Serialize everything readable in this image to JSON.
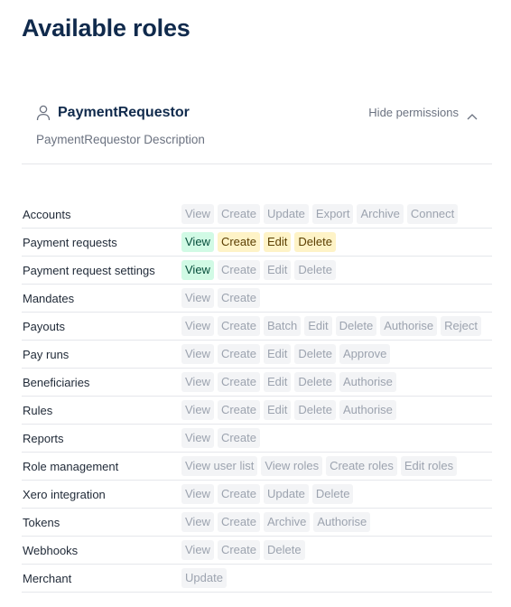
{
  "page": {
    "title": "Available roles"
  },
  "role": {
    "name": "PaymentRequestor",
    "description": "PaymentRequestor Description",
    "toggle_label": "Hide permissions",
    "icon": "person-icon"
  },
  "colors": {
    "granted_view": "#d1fae5",
    "granted_edit": "#fef3c7",
    "not_granted": "#f3f4f6"
  },
  "permissions": [
    {
      "label": "Accounts",
      "actions": [
        {
          "text": "View",
          "state": "off"
        },
        {
          "text": "Create",
          "state": "off"
        },
        {
          "text": "Update",
          "state": "off"
        },
        {
          "text": "Export",
          "state": "off"
        },
        {
          "text": "Archive",
          "state": "off"
        },
        {
          "text": "Connect",
          "state": "off"
        }
      ]
    },
    {
      "label": "Payment requests",
      "actions": [
        {
          "text": "View",
          "state": "green"
        },
        {
          "text": "Create",
          "state": "yellow"
        },
        {
          "text": "Edit",
          "state": "yellow"
        },
        {
          "text": "Delete",
          "state": "yellow"
        }
      ]
    },
    {
      "label": "Payment request settings",
      "actions": [
        {
          "text": "View",
          "state": "green"
        },
        {
          "text": "Create",
          "state": "off"
        },
        {
          "text": "Edit",
          "state": "off"
        },
        {
          "text": "Delete",
          "state": "off"
        }
      ]
    },
    {
      "label": "Mandates",
      "actions": [
        {
          "text": "View",
          "state": "off"
        },
        {
          "text": "Create",
          "state": "off"
        }
      ]
    },
    {
      "label": "Payouts",
      "actions": [
        {
          "text": "View",
          "state": "off"
        },
        {
          "text": "Create",
          "state": "off"
        },
        {
          "text": "Batch",
          "state": "off"
        },
        {
          "text": "Edit",
          "state": "off"
        },
        {
          "text": "Delete",
          "state": "off"
        },
        {
          "text": "Authorise",
          "state": "off"
        },
        {
          "text": "Reject",
          "state": "off"
        }
      ]
    },
    {
      "label": "Pay runs",
      "actions": [
        {
          "text": "View",
          "state": "off"
        },
        {
          "text": "Create",
          "state": "off"
        },
        {
          "text": "Edit",
          "state": "off"
        },
        {
          "text": "Delete",
          "state": "off"
        },
        {
          "text": "Approve",
          "state": "off"
        }
      ]
    },
    {
      "label": "Beneficiaries",
      "actions": [
        {
          "text": "View",
          "state": "off"
        },
        {
          "text": "Create",
          "state": "off"
        },
        {
          "text": "Edit",
          "state": "off"
        },
        {
          "text": "Delete",
          "state": "off"
        },
        {
          "text": "Authorise",
          "state": "off"
        }
      ]
    },
    {
      "label": "Rules",
      "actions": [
        {
          "text": "View",
          "state": "off"
        },
        {
          "text": "Create",
          "state": "off"
        },
        {
          "text": "Edit",
          "state": "off"
        },
        {
          "text": "Delete",
          "state": "off"
        },
        {
          "text": "Authorise",
          "state": "off"
        }
      ]
    },
    {
      "label": "Reports",
      "actions": [
        {
          "text": "View",
          "state": "off"
        },
        {
          "text": "Create",
          "state": "off"
        }
      ]
    },
    {
      "label": "Role management",
      "actions": [
        {
          "text": "View user list",
          "state": "off"
        },
        {
          "text": "View roles",
          "state": "off"
        },
        {
          "text": "Create roles",
          "state": "off"
        },
        {
          "text": "Edit roles",
          "state": "off"
        }
      ]
    },
    {
      "label": "Xero integration",
      "actions": [
        {
          "text": "View",
          "state": "off"
        },
        {
          "text": "Create",
          "state": "off"
        },
        {
          "text": "Update",
          "state": "off"
        },
        {
          "text": "Delete",
          "state": "off"
        }
      ]
    },
    {
      "label": "Tokens",
      "actions": [
        {
          "text": "View",
          "state": "off"
        },
        {
          "text": "Create",
          "state": "off"
        },
        {
          "text": "Archive",
          "state": "off"
        },
        {
          "text": "Authorise",
          "state": "off"
        }
      ]
    },
    {
      "label": "Webhooks",
      "actions": [
        {
          "text": "View",
          "state": "off"
        },
        {
          "text": "Create",
          "state": "off"
        },
        {
          "text": "Delete",
          "state": "off"
        }
      ]
    },
    {
      "label": "Merchant",
      "actions": [
        {
          "text": "Update",
          "state": "off"
        }
      ]
    }
  ]
}
